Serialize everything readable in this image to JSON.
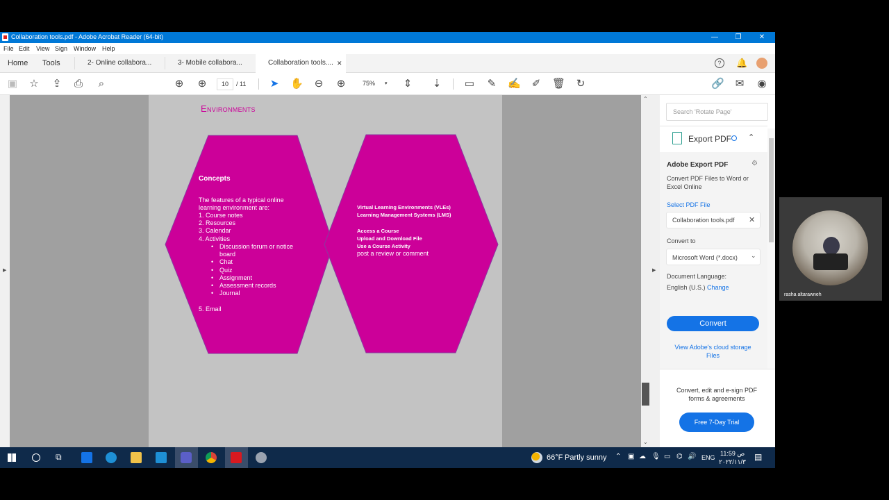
{
  "window": {
    "title": "Collaboration tools.pdf - Adobe Acrobat Reader (64-bit)",
    "controls": {
      "minimize": "—",
      "restore": "❐",
      "close": "✕"
    }
  },
  "menu": [
    "File",
    "Edit",
    "View",
    "Sign",
    "Window",
    "Help"
  ],
  "tabs": {
    "home": "Home",
    "tools": "Tools",
    "doc1": "2- Online collabora...",
    "doc2": "3- Mobile collabora...",
    "doc3": "Collaboration tools....",
    "close": "✕"
  },
  "toolbar": {
    "page_current": "10",
    "page_total": "/  11",
    "zoom": "75%",
    "zoom_caret": "▾"
  },
  "document": {
    "heading": "Environments",
    "left_hex": {
      "title": "Concepts",
      "intro": "The features of a typical online learning environment are:",
      "items": [
        "1. Course notes",
        "2. Resources",
        "3. Calendar",
        "4. Activities"
      ],
      "subitems": [
        "Discussion forum or notice board",
        "Chat",
        "Quiz",
        "Assignment",
        "Assessment records",
        "Journal"
      ],
      "email": "5. Email"
    },
    "right_hex": {
      "l1": "Virtual Learning Environments (VLEs)",
      "l2": "Learning Management Systems (LMS)",
      "l3": "Access a Course",
      "l4": "Upload and Download File",
      "l5": "Use a Course Activity",
      "l6": "post a review or comment"
    },
    "hex_color": "#cc0099"
  },
  "right_panel": {
    "search_placeholder": "Search 'Rotate Page'",
    "export_header": "Export PDF",
    "card_title": "Adobe Export PDF",
    "card_desc": "Convert PDF Files to Word or Excel Online",
    "select_file": "Select PDF File",
    "file_name": "Collaboration tools.pdf",
    "convert_to": "Convert to",
    "format": "Microsoft Word (*.docx)",
    "doc_lang_label": "Document Language:",
    "doc_lang": "English (U.S.)",
    "change": "Change",
    "convert_btn": "Convert",
    "cloud_link": "View Adobe's cloud storage Files",
    "promo": "Convert, edit and e-sign PDF forms & agreements",
    "trial_btn": "Free 7-Day Trial",
    "accent": "#1473e6"
  },
  "taskbar": {
    "weather_temp": "66°F",
    "weather_desc": "Partly sunny",
    "lang": "ENG",
    "time": "11:59 ص",
    "date": "٢٠٢٢/١١/٣"
  },
  "video": {
    "name": "rasha altarawneh"
  }
}
